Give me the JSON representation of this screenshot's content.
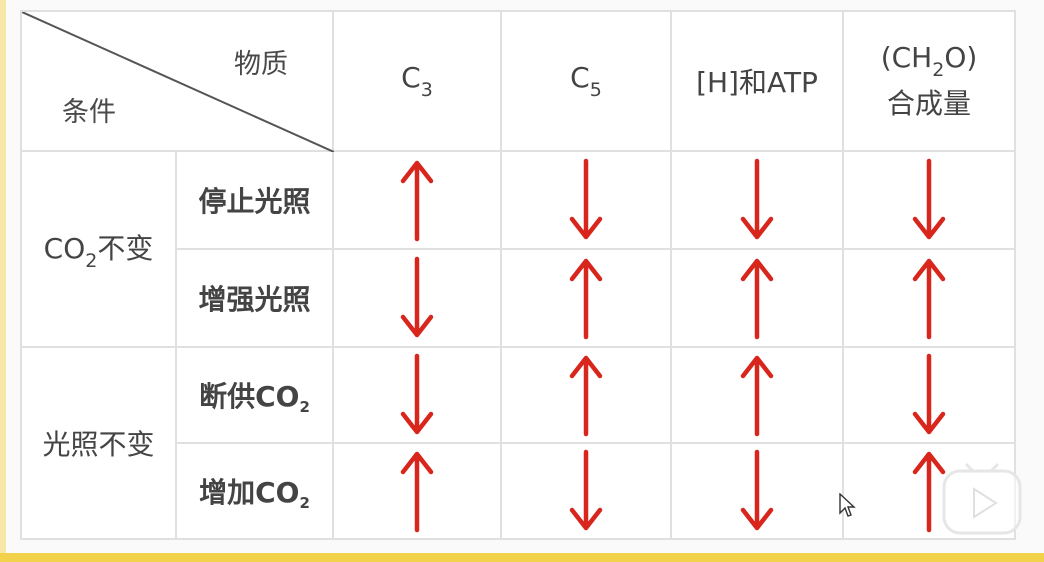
{
  "header": {
    "material_label": "物质",
    "condition_label": "条件",
    "columns": [
      {
        "main": "C",
        "sub": "3"
      },
      {
        "main": "C",
        "sub": "5"
      },
      {
        "main": "[H]和ATP"
      },
      {
        "pre": "(CH",
        "sub": "2",
        "post": "O)",
        "line2": "合成量"
      }
    ]
  },
  "groups": [
    {
      "pre": "CO",
      "sub": "2",
      "post": "不变"
    },
    {
      "label": "光照不变"
    }
  ],
  "rows": [
    {
      "pre": "停止光照",
      "sub": "",
      "arrows": [
        "up",
        "down",
        "down",
        "down"
      ]
    },
    {
      "pre": "增强光照",
      "sub": "",
      "arrows": [
        "down",
        "up",
        "up",
        "up"
      ]
    },
    {
      "pre": "断供CO",
      "sub": "2",
      "arrows": [
        "down",
        "up",
        "up",
        "down"
      ]
    },
    {
      "pre": "增加CO",
      "sub": "2",
      "arrows": [
        "up",
        "down",
        "down",
        "up"
      ]
    }
  ],
  "colors": {
    "arrow": "#d9261c",
    "grid": "#e0e0e0",
    "text": "#444444"
  }
}
